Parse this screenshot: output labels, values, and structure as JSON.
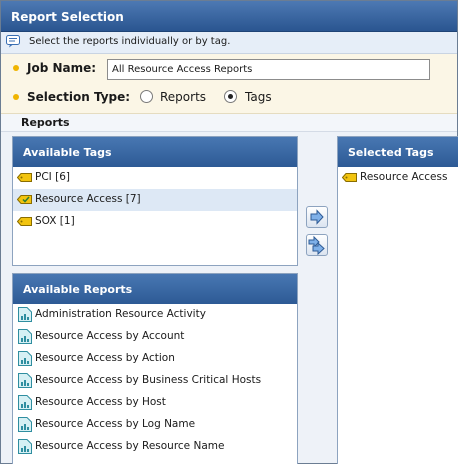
{
  "window": {
    "title": "Report Selection"
  },
  "hint": {
    "text": "Select the reports individually or by tag."
  },
  "job": {
    "label": "Job Name:",
    "value": "All Resource Access Reports"
  },
  "selection_type": {
    "label": "Selection Type:",
    "options": [
      {
        "label": "Reports",
        "selected": false
      },
      {
        "label": "Tags",
        "selected": true
      }
    ]
  },
  "section": {
    "title": "Reports"
  },
  "available_tags": {
    "title": "Available Tags",
    "items": [
      {
        "label": "PCI [6]",
        "highlighted": false
      },
      {
        "label": "Resource Access [7]",
        "highlighted": true
      },
      {
        "label": "SOX [1]",
        "highlighted": false
      }
    ]
  },
  "selected_tags": {
    "title": "Selected Tags",
    "items": [
      {
        "label": "Resource Access"
      }
    ]
  },
  "available_reports": {
    "title": "Available Reports",
    "items": [
      {
        "label": "Administration Resource Activity"
      },
      {
        "label": "Resource Access by Account"
      },
      {
        "label": "Resource Access by Action"
      },
      {
        "label": "Resource Access by Business Critical Hosts"
      },
      {
        "label": "Resource Access by Host"
      },
      {
        "label": "Resource Access by Log Name"
      },
      {
        "label": "Resource Access by Resource Name"
      }
    ]
  },
  "colors": {
    "header_blue": "#2d5a95",
    "tag_yellow": "#f2c40f",
    "highlight": "#dde8f5",
    "bullet": "#f0b400"
  }
}
